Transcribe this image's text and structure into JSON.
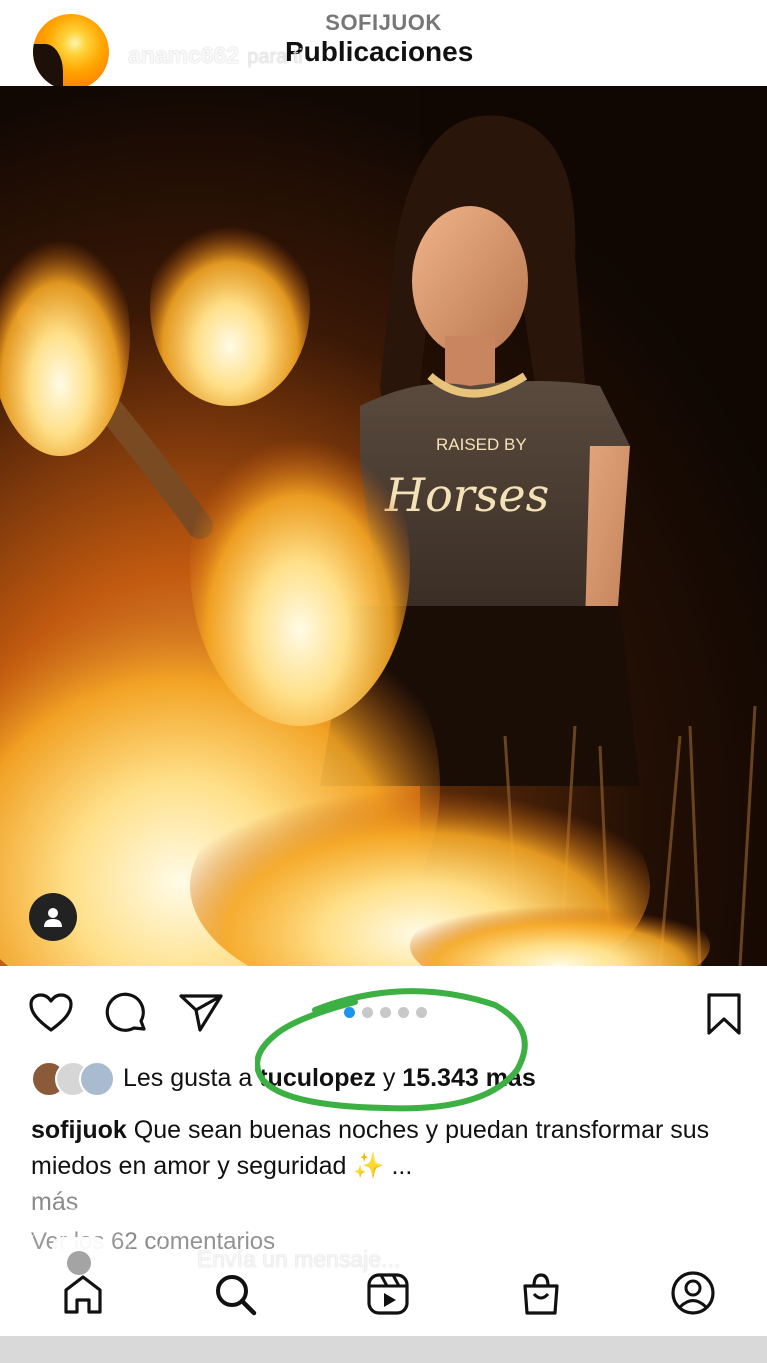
{
  "header": {
    "account_handle": "SOFIJUOK",
    "title": "Publicaciones"
  },
  "story": {
    "username": "anamc662",
    "subtitle": "para ti"
  },
  "post": {
    "photo_text": {
      "shirt_line1": "RAISED BY",
      "shirt_line2": "Horses"
    },
    "carousel": {
      "count": 5,
      "active_index": 0
    },
    "likes": {
      "prefix": "Les gusta a",
      "user": "tuculopez",
      "connector": "y",
      "count": "15.343 más"
    },
    "caption": {
      "username": "sofijuok",
      "text": "Que sean buenas noches y puedan transformar sus miedos en amor y seguridad ✨ ...",
      "more": "más"
    },
    "view_comments": "Ver los 62 comentarios"
  },
  "reply": {
    "placeholder": "Envía un mensaje..."
  },
  "icons": {
    "like": "heart-icon",
    "comment": "comment-icon",
    "share": "send-icon",
    "save": "bookmark-icon",
    "tag": "person-tag-icon",
    "camera": "camera-icon",
    "home": "home-icon",
    "search": "search-icon",
    "reels": "reels-icon",
    "shop": "shop-icon",
    "profile": "profile-icon"
  },
  "colors": {
    "carousel_active": "#1a95f0",
    "annotation_circle": "#3cb043",
    "text_primary": "#111111",
    "text_secondary": "#8a8a8a"
  }
}
